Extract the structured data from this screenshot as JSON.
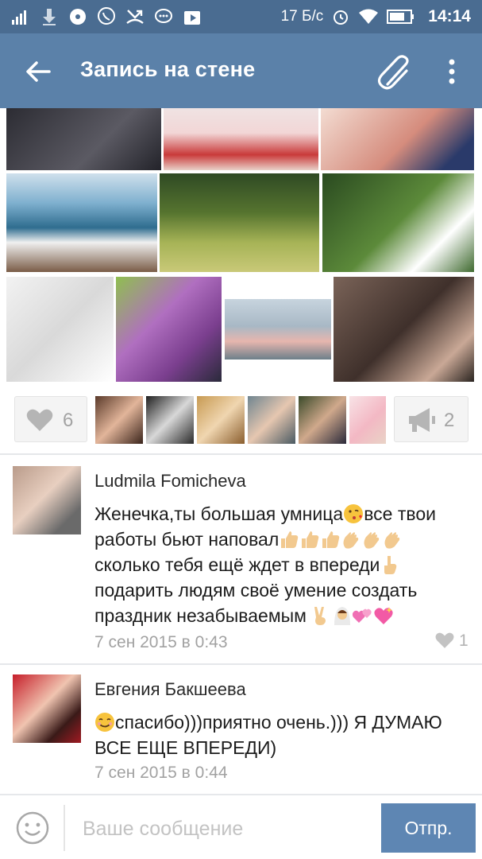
{
  "status_bar": {
    "speed": "17 Б/с",
    "time": "14:14",
    "icons": [
      "signal-icon",
      "download-icon",
      "music-icon",
      "viber-icon",
      "missed-call-icon",
      "chat-icon",
      "play-store-icon",
      "alarm-icon",
      "wifi-icon",
      "battery-icon"
    ]
  },
  "toolbar": {
    "title": "Запись на стене",
    "back_icon": "arrow-left-icon",
    "attach_icon": "paperclip-icon",
    "menu_icon": "more-vertical-icon"
  },
  "photos": {
    "count": 11,
    "colors": [
      "#3c3b44",
      "#c53a3a",
      "#d99a8c",
      "#5b8fb3",
      "#7a9a48",
      "#3f6a2f",
      "#d8d8d8",
      "#9b5fa8",
      "#9fb2c0",
      "#4a3a34"
    ]
  },
  "likes": {
    "like_count": "6",
    "repost_count": "2",
    "like_icon": "heart-icon",
    "repost_icon": "megaphone-icon"
  },
  "comments": [
    {
      "author": "Ludmila Fomicheva",
      "text_parts": [
        "Женечка,ты большая умница",
        "все твои работы бьют наповал",
        "сколько тебя ещё  ждет в впереди",
        "подарить людям своё умение  создать праздник незабываемым "
      ],
      "date": "7 сен 2015 в 0:43",
      "likes": "1"
    },
    {
      "author": "Евгения Бакшеева",
      "text": "спасибо)))приятно очень.))) Я ДУМАЮ ВСЕ ЕЩЕ ВПЕРЕДИ)",
      "date": "7 сен 2015 в 0:44"
    }
  ],
  "composer": {
    "placeholder": "Ваше сообщение",
    "send_label": "Отпр.",
    "emoji_icon": "smiley-icon"
  }
}
